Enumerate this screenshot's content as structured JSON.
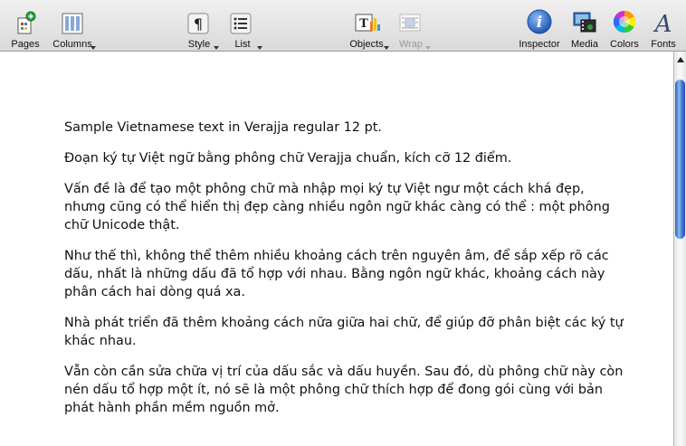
{
  "toolbar": {
    "pages": "Pages",
    "columns": "Columns",
    "style": "Style",
    "list": "List",
    "objects": "Objects",
    "wrap": "Wrap",
    "inspector": "Inspector",
    "media": "Media",
    "colors": "Colors",
    "fonts": "Fonts",
    "style_icon_glyph": "¶",
    "fonts_icon_glyph": "A"
  },
  "document": {
    "paragraphs": [
      "Sample Vietnamese text in Verajja regular 12 pt.",
      "Đoạn ký tự Việt ngữ bằng phông chữ Verajja chuẩn, kích cỡ 12 điểm.",
      "Vấn đề là để tạo một phông chữ mà nhập mọi ký tự Việt ngư một cách khá đẹp, nhưng cũng có thể hiển thị đẹp càng nhiều ngôn ngữ khác càng có thể : một phông chữ Unicode thật.",
      "Như thế thì, không thể thêm nhiều khoảng cách trên nguyên âm, để sắp xếp rõ các dấu, nhất là những dấu đã tổ hợp với nhau. Bằng ngôn ngữ khác, khoảng cách này phân cách hai dòng quá xa.",
      "Nhà phát triển đã thêm khoảng cách nữa giữa hai chữ, để giúp đỡ phân biệt các ký tự khác nhau.",
      "Vẫn còn cần sửa chữa vị trí của dấu sắc và dấu huyền. Sau đó, dù phông chữ này còn nén dấu tổ hợp một ít, nó sẽ là một phông chữ thích hợp để đong gói cùng với bản phát hành phần mềm nguồn mở."
    ]
  },
  "colors": {
    "inspector_blue": "#2f6fd0",
    "scroll_thumb": "#3d75cf"
  }
}
